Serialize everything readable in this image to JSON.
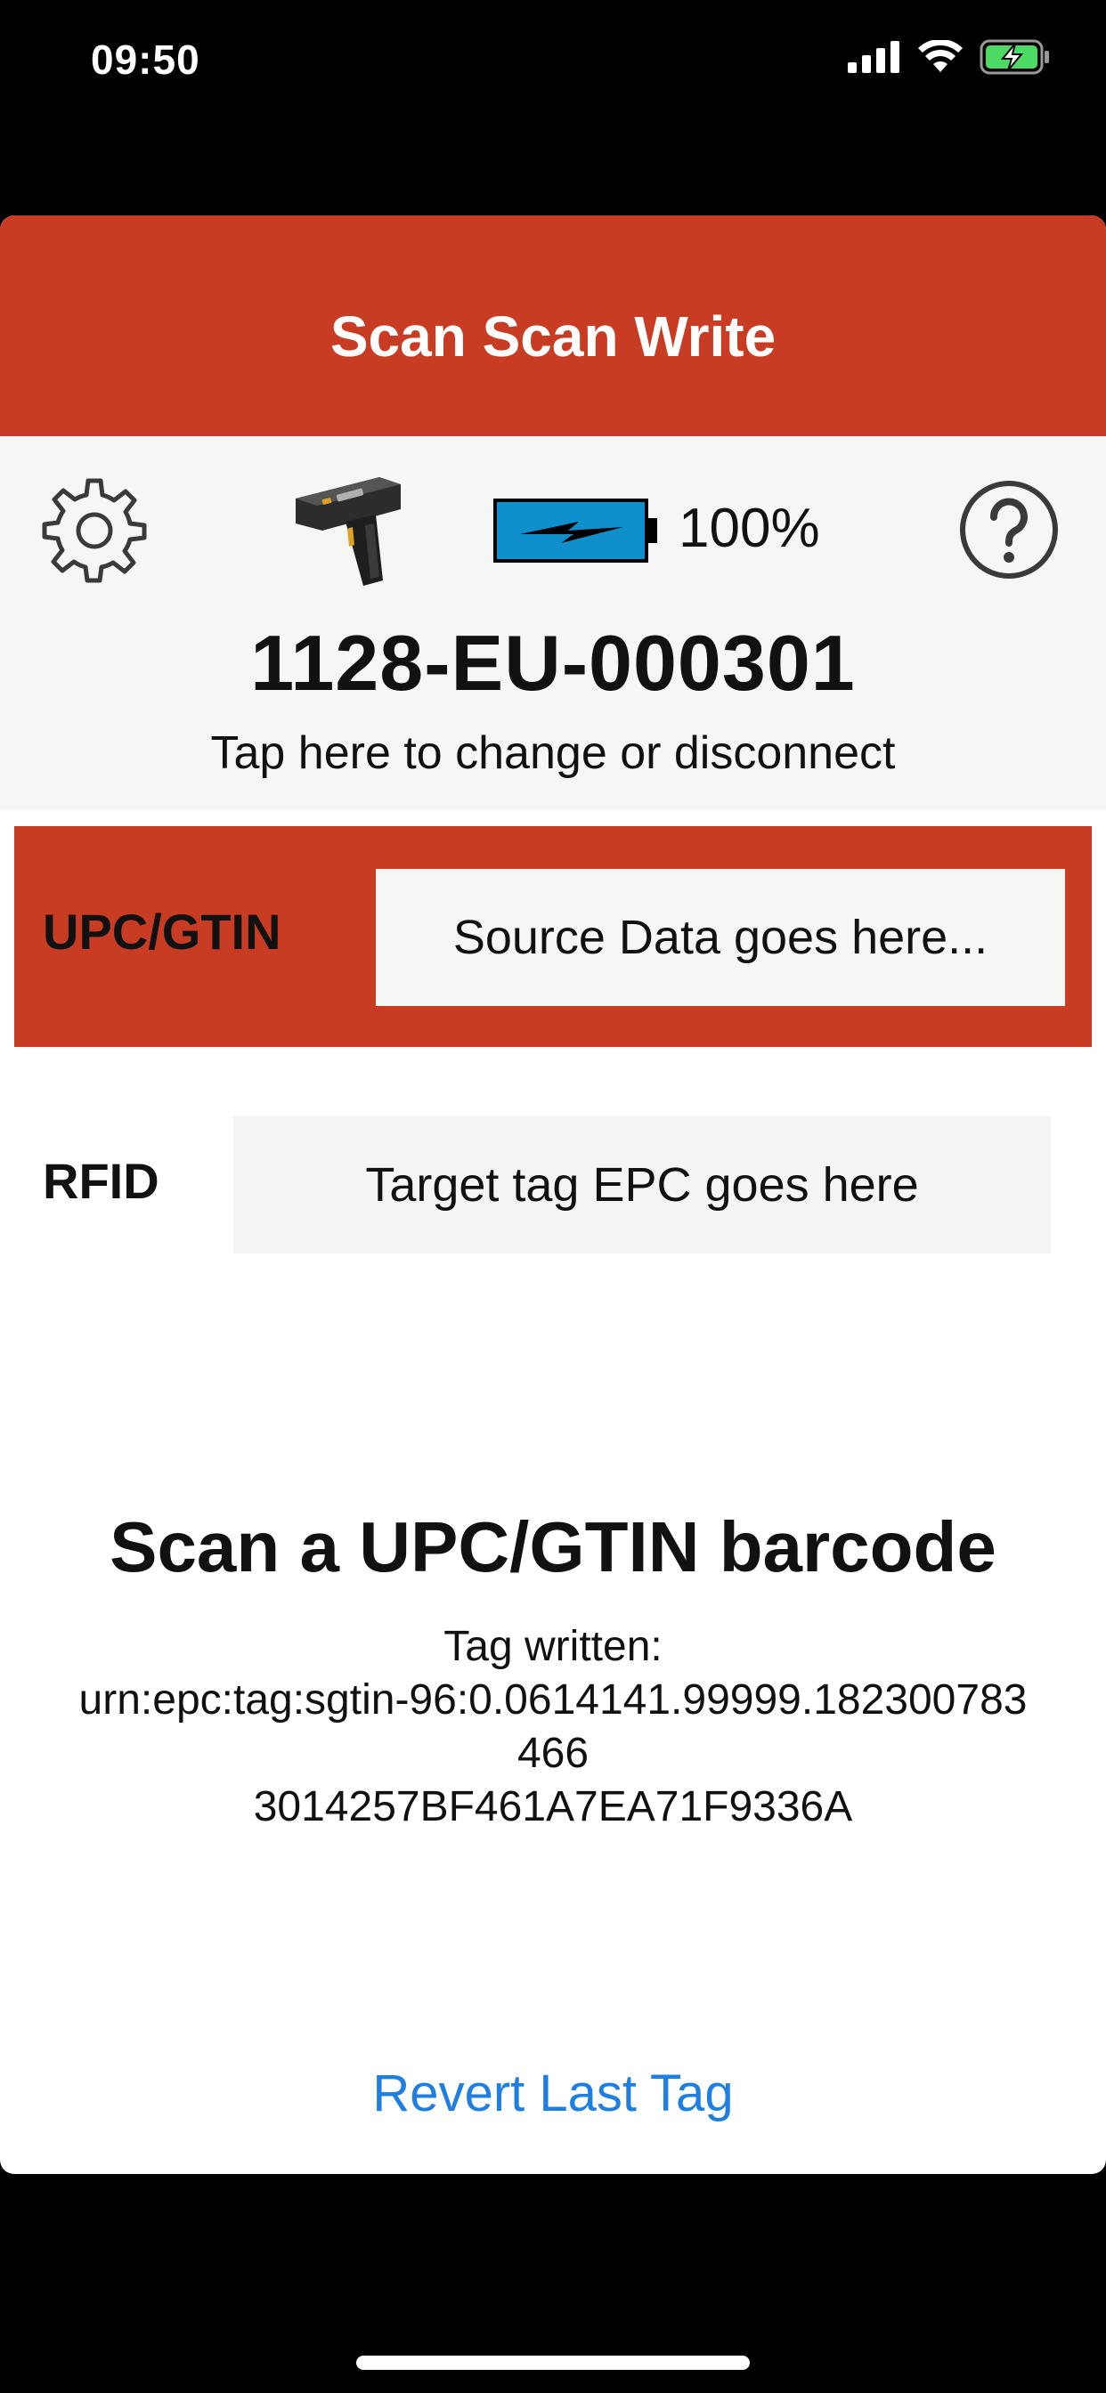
{
  "status_bar": {
    "time": "09:50",
    "icons": [
      "cellular-signal-icon",
      "wifi-icon",
      "battery-charging-icon"
    ]
  },
  "header": {
    "title": "Scan Scan Write",
    "background_color": "#c83c24"
  },
  "device": {
    "battery_percent": "100%",
    "device_id": "1128-EU-000301",
    "hint": "Tap here to change or disconnect",
    "icons": [
      "gear-icon",
      "rfid-scanner-image",
      "battery-icon",
      "help-icon"
    ]
  },
  "upc": {
    "label": "UPC/GTIN",
    "placeholder": "Source Data goes here..."
  },
  "rfid": {
    "label": "RFID",
    "placeholder": "Target tag EPC goes here"
  },
  "status": {
    "prompt": "Scan a UPC/GTIN barcode",
    "tag_written_label": "Tag written:",
    "tag_uri_line1": "urn:epc:tag:sgtin-96:0.0614141.99999.182300783",
    "tag_uri_line2": "466",
    "tag_hex": "3014257BF461A7EA71F9336A"
  },
  "actions": {
    "revert_label": "Revert Last Tag",
    "link_color": "#1f7fe0"
  }
}
